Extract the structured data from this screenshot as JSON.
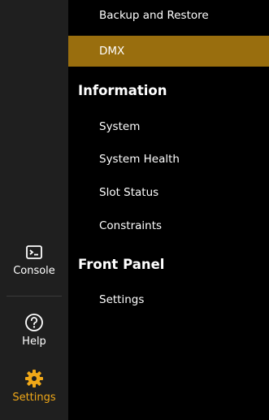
{
  "sidebar": {
    "console_label": "Console",
    "help_label": "Help",
    "settings_label": "Settings",
    "active": "settings",
    "icons": {
      "console": "terminal-icon",
      "help": "help-icon",
      "settings": "gear-icon"
    }
  },
  "menu": {
    "items_top": [
      {
        "label": "Backup and Restore"
      },
      {
        "label": "DMX",
        "selected": true
      }
    ],
    "information": {
      "heading": "Information",
      "items": [
        {
          "label": "System"
        },
        {
          "label": "System Health"
        },
        {
          "label": "Slot Status"
        },
        {
          "label": "Constraints"
        }
      ]
    },
    "front_panel": {
      "heading": "Front Panel",
      "items": [
        {
          "label": "Settings"
        }
      ]
    }
  },
  "colors": {
    "accent": "#996e0e",
    "active_icon": "#f0a818",
    "rail_bg": "#1f1f1f",
    "menu_bg": "#000000"
  }
}
